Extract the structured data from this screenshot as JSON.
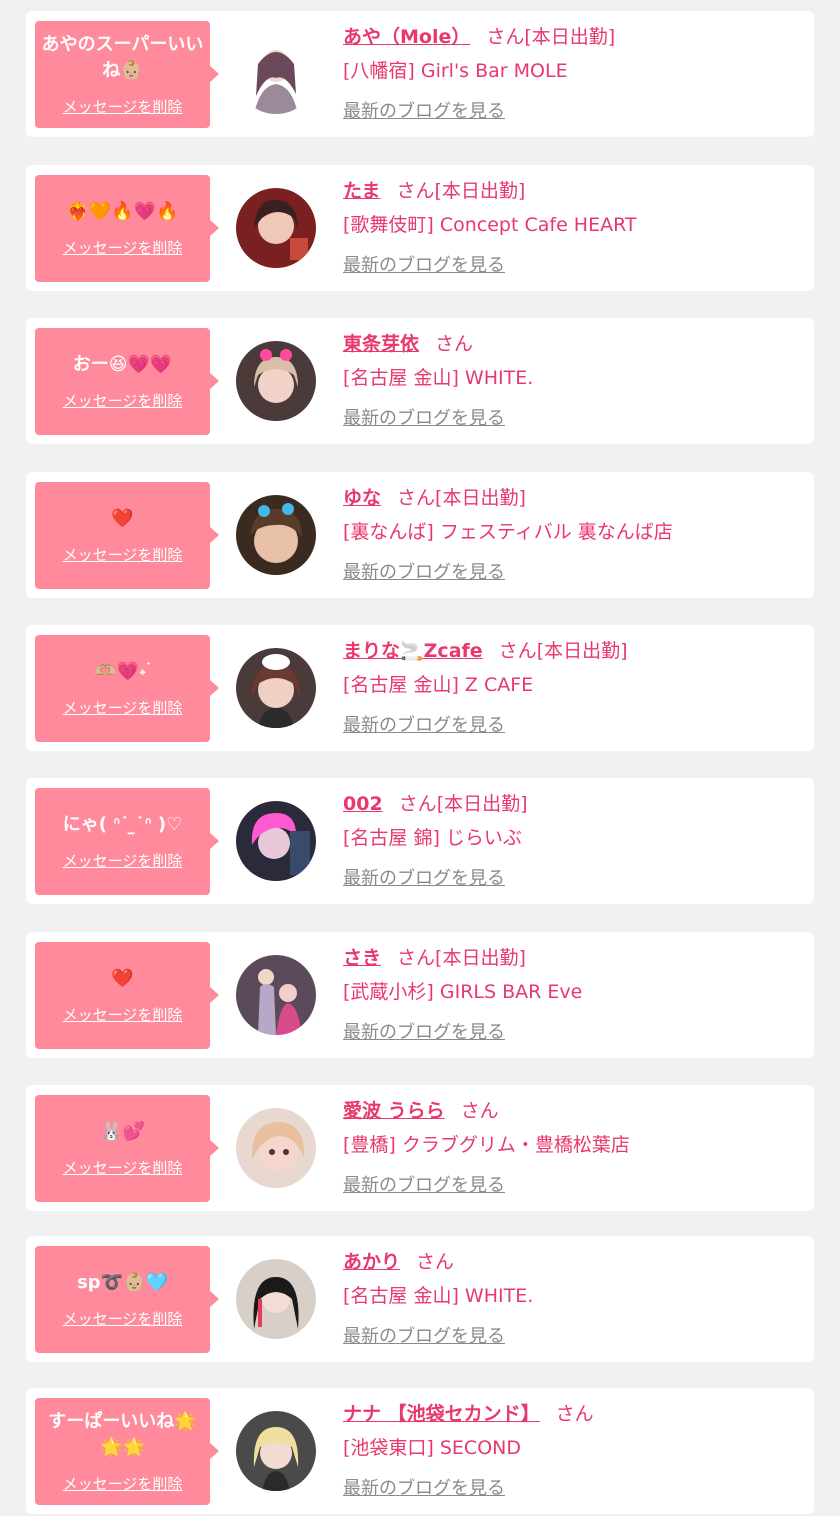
{
  "items": [
    {
      "message": "あやのスーパーいいね👶🏼",
      "delete_label": "メッセージを削除",
      "name": "あや（Mole）",
      "honorific": "さん",
      "attendance": "[本日出勤]",
      "shop": "[八幡宿] Girl's Bar MOLE",
      "blog_label": "最新のブログを見る",
      "avatar_color": "#7a5a6a"
    },
    {
      "message": "❤️‍🔥🧡‍🔥💗‍🔥",
      "delete_label": "メッセージを削除",
      "name": "たま",
      "honorific": "さん",
      "attendance": "[本日出勤]",
      "shop": "[歌舞伎町] Concept Cafe HEART",
      "blog_label": "最新のブログを見る",
      "avatar_color": "#8a2a2a"
    },
    {
      "message": "おー😆💗💗",
      "delete_label": "メッセージを削除",
      "name": "東条芽依",
      "honorific": "さん",
      "attendance": "",
      "shop": "[名古屋 金山] WHITE.",
      "blog_label": "最新のブログを見る",
      "avatar_color": "#9a7a7a"
    },
    {
      "message": "❤️",
      "delete_label": "メッセージを削除",
      "name": "ゆな",
      "honorific": "さん",
      "attendance": "[本日出勤]",
      "shop": "[裏なんば] フェスティバル 裏なんば店",
      "blog_label": "最新のブログを見る",
      "avatar_color": "#6a4a3a"
    },
    {
      "message": "🫶🏼💗˖ ࣪",
      "delete_label": "メッセージを削除",
      "name": "まりな🚬Zcafe",
      "honorific": "さん",
      "attendance": "[本日出勤]",
      "shop": "[名古屋 金山] Z CAFE",
      "blog_label": "最新のブログを見る",
      "avatar_color": "#5a4a4a"
    },
    {
      "message": "にゃ( ᐢ˙ ̫˙ᐢ )♡",
      "delete_label": "メッセージを削除",
      "name": "002",
      "honorific": "さん",
      "attendance": "[本日出勤]",
      "shop": "[名古屋 錦] じらいぶ",
      "blog_label": "最新のブログを見る",
      "avatar_color": "#3a3a5a"
    },
    {
      "message": "❤️",
      "delete_label": "メッセージを削除",
      "name": "さき",
      "honorific": "さん",
      "attendance": "[本日出勤]",
      "shop": "[武蔵小杉] GIRLS BAR Eve",
      "blog_label": "最新のブログを見る",
      "avatar_color": "#6a5a6a"
    },
    {
      "message": "🐰💕",
      "delete_label": "メッセージを削除",
      "name": "愛波 うらら",
      "honorific": "さん",
      "attendance": "",
      "shop": "[豊橋] クラブグリム・豊橋松葉店",
      "blog_label": "最新のブログを見る",
      "avatar_color": "#c8aaa0"
    },
    {
      "message": "sp➰👶🏼🩵",
      "delete_label": "メッセージを削除",
      "name": "あかり",
      "honorific": "さん",
      "attendance": "",
      "shop": "[名古屋 金山] WHITE.",
      "blog_label": "最新のブログを見る",
      "avatar_color": "#3a2a2a"
    },
    {
      "message": "すーぱーいいね🌟🌟🌟",
      "delete_label": "メッセージを削除",
      "name": "ナナ 【池袋セカンド】",
      "honorific": "さん",
      "attendance": "",
      "shop": "[池袋東口] SECOND",
      "blog_label": "最新のブログを見る",
      "avatar_color": "#5a5a5a"
    }
  ]
}
